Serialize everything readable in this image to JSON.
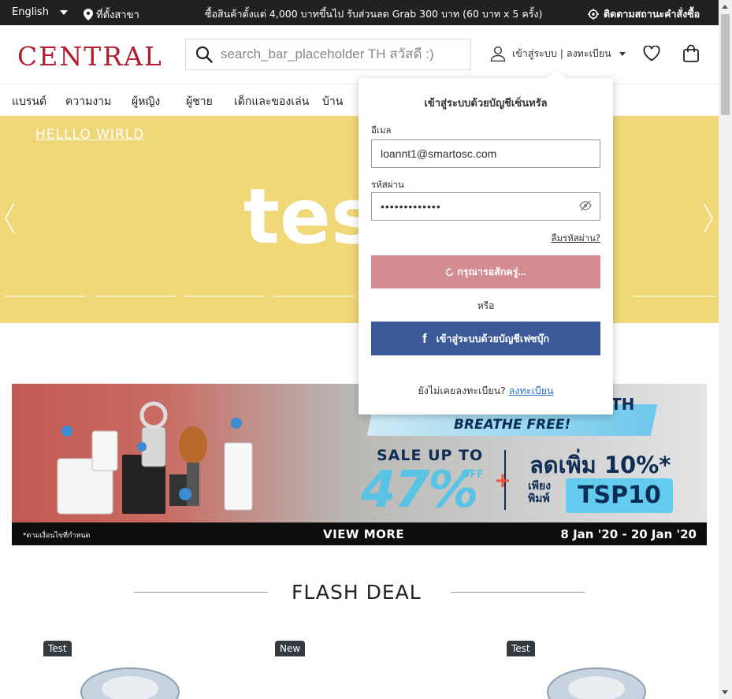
{
  "topbar": {
    "language": "English",
    "store_locator": "ที่ตั้งสาขา",
    "promo": "ซื้อสินค้าตั้งแต่ 4,000 บาทขึ้นไป รับส่วนลด Grab 300 บาท (60 บาท x 5 ครั้ง)",
    "track_order": "ติดตามสถานะคำสั่งซื้อ"
  },
  "header": {
    "logo": "CENTRAL",
    "search_placeholder": "search_bar_placeholder TH สวัสดี :)",
    "login_label": "เข้าสู่ระบบ | ลงทะเบียน"
  },
  "nav": {
    "items": [
      "แบรนด์",
      "ความงาม",
      "ผู้หญิง",
      "ผู้ชาย",
      "เด็กและของเล่น",
      "บ้าน"
    ]
  },
  "hero": {
    "link_text": "HELLLO WIRLD",
    "big_text": "tes"
  },
  "banner": {
    "headline_suffix": "TH",
    "breathe": "BREATHE FREE!",
    "sale_label": "SALE UP TO",
    "sale_percent": "47%",
    "sale_off": "OFF",
    "extra_label": "ลดเพิ่ม 10%*",
    "only_label": "เพียง พิมพ์",
    "code": "TSP10",
    "footnote": "*ตามเงื่อนไขที่กำหนด",
    "view_more": "VIEW MORE",
    "date_range": "8 Jan '20 - 20 Jan '20"
  },
  "flash_deal": {
    "title": "FLASH DEAL",
    "tags": [
      "Test",
      "New",
      "Test"
    ]
  },
  "login_popup": {
    "title": "เข้าสู่ระบบด้วยบัญชีเซ็นทรัล",
    "email_label": "อีเมล",
    "email_value": "loannt1@smartosc.com",
    "password_label": "รหัสผ่าน",
    "password_value": "•••••••••••••",
    "forgot_password": "ลืมรหัสผ่าน?",
    "wait_button": "กรุณารอสักครู่...",
    "or_text": "หรือ",
    "facebook_button": "เข้าสู่ระบบด้วยบัญชีเฟซบุ๊ก",
    "no_account": "ยังไม่เคยลงทะเบียน?",
    "register_link": "ลงทะเบียน"
  },
  "colors": {
    "brand_red": "#b01e2f",
    "hero_yellow": "#f0d777",
    "facebook_blue": "#3b5998",
    "wait_button_pink": "#d48c93",
    "topbar_black": "#212121"
  }
}
